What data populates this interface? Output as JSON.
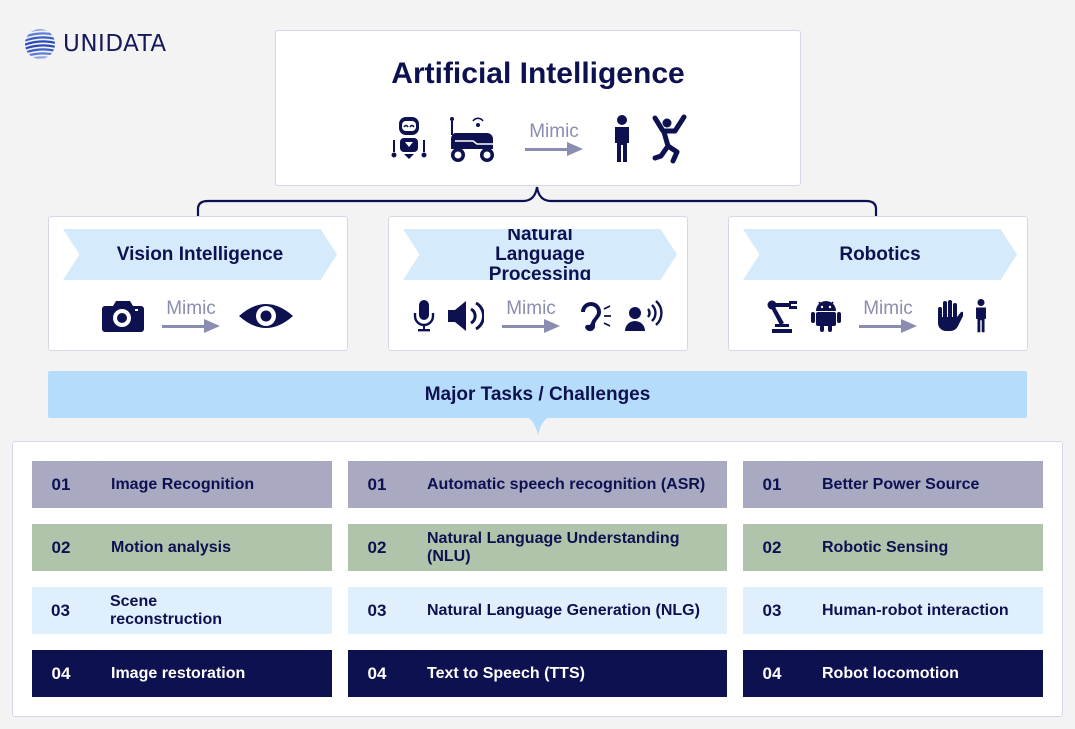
{
  "brand": {
    "name": "UNIDATA"
  },
  "root": {
    "title": "Artificial Intelligence",
    "mimic_label": "Mimic",
    "source_icons": [
      "robot-icon",
      "rover-robot-icon"
    ],
    "target_icons": [
      "person-standing-icon",
      "person-jumping-icon"
    ]
  },
  "categories": [
    {
      "title": "Vision Intelligence",
      "mimic_label": "Mimic",
      "source_icons": [
        "camera-icon"
      ],
      "target_icons": [
        "eye-icon"
      ]
    },
    {
      "title": "Natural Language Processing",
      "mimic_label": "Mimic",
      "source_icons": [
        "microphone-icon",
        "speaker-icon"
      ],
      "target_icons": [
        "ear-icon",
        "person-speaking-icon"
      ]
    },
    {
      "title": "Robotics",
      "mimic_label": "Mimic",
      "source_icons": [
        "robotic-arm-icon",
        "android-icon"
      ],
      "target_icons": [
        "hand-icon",
        "person-standing-icon"
      ]
    }
  ],
  "tasks_header": "Major Tasks / Challenges",
  "task_columns": [
    {
      "category": "Vision Intelligence",
      "tasks": [
        {
          "num": "01",
          "label": "Image Recognition"
        },
        {
          "num": "02",
          "label": "Motion analysis"
        },
        {
          "num": "03",
          "label": "Scene reconstruction"
        },
        {
          "num": "04",
          "label": "Image restoration"
        }
      ]
    },
    {
      "category": "Natural Language Processing",
      "tasks": [
        {
          "num": "01",
          "label": "Automatic speech recognition (ASR)"
        },
        {
          "num": "02",
          "label": "Natural Language Understanding (NLU)"
        },
        {
          "num": "03",
          "label": "Natural Language Generation (NLG)"
        },
        {
          "num": "04",
          "label": "Text to Speech (TTS)"
        }
      ]
    },
    {
      "category": "Robotics",
      "tasks": [
        {
          "num": "01",
          "label": "Better Power Source"
        },
        {
          "num": "02",
          "label": "Robotic Sensing"
        },
        {
          "num": "03",
          "label": "Human-robot interaction"
        },
        {
          "num": "04",
          "label": "Robot locomotion"
        }
      ]
    }
  ],
  "colors": {
    "navy": "#0d1150",
    "row1": "#a9a9c2",
    "row2": "#b0c4ab",
    "row3": "#dff0fc",
    "row4": "#0d1150",
    "banner_light": "#d5ebfb",
    "banner_tasks": "#b5dcfa",
    "mimic_gray": "#8a8db0"
  }
}
